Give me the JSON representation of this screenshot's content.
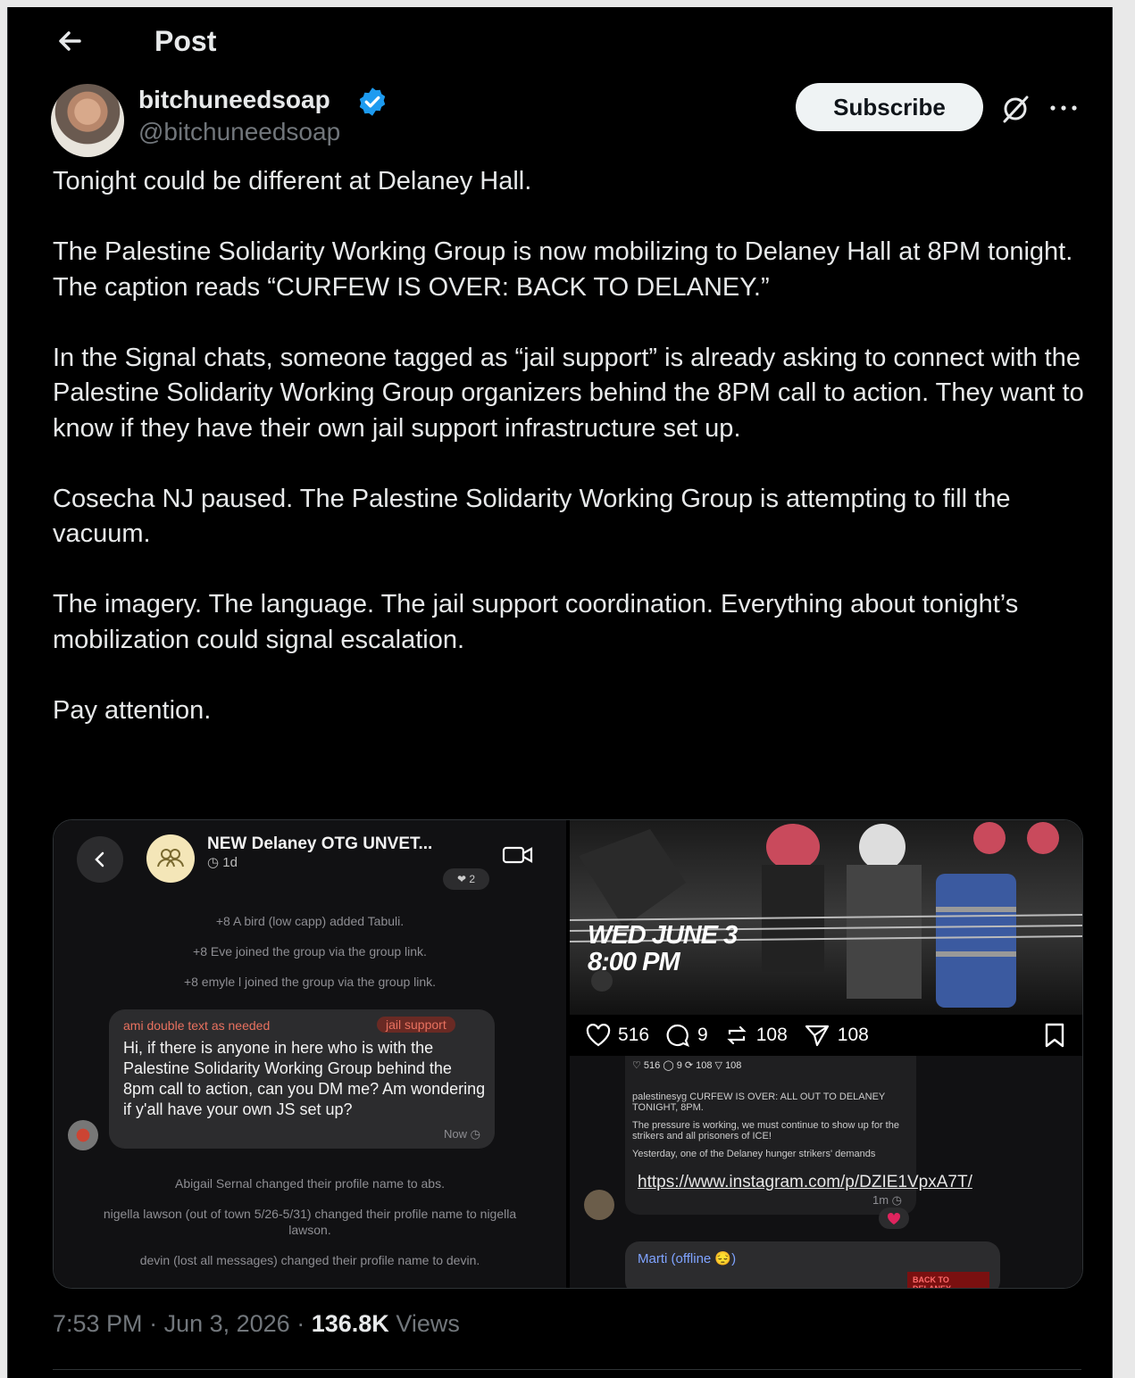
{
  "header": {
    "title": "Post"
  },
  "author": {
    "display_name": "bitchuneedsoap",
    "handle": "@bitchuneedsoap",
    "verified": true
  },
  "actions": {
    "subscribe_label": "Subscribe"
  },
  "tweet": {
    "paragraphs": [
      "Tonight could be different at Delaney Hall.",
      "The Palestine Solidarity Working Group is now mobilizing to Delaney Hall at 8PM tonight. The caption reads “CURFEW IS OVER: BACK TO DELANEY.”",
      "In the Signal chats, someone tagged as “jail support” is already asking to connect with the Palestine Solidarity Working Group organizers behind the 8PM call to action. They want to know if they have their own jail support infrastructure set up.",
      "Cosecha NJ paused. The Palestine Solidarity Working Group is attempting to fill the vacuum.",
      "The imagery. The language. The jail support coordination. Everything about tonight’s mobilization could signal escalation.",
      "Pay attention."
    ]
  },
  "media_left": {
    "group_title": "NEW Delaney OTG UNVET...",
    "group_sub": "◷ 1d",
    "reaction": "❤ 2",
    "system_lines": [
      "+8 A bird (low capp) added Tabuli.",
      "+8 Eve joined the group via the group link.",
      "+8 emyle l joined the group via the group link."
    ],
    "bubble": {
      "sender": "ami double text as needed",
      "tag": "jail support",
      "text": "Hi, if there is anyone in here who is with the Palestine Solidarity Working Group behind the 8pm call to action, can you DM me? Am wondering if y'all have your own JS set up?",
      "time": "Now ◷"
    },
    "system_lines_after": [
      "Abigail Sernal changed their profile name to abs.",
      "nigella lawson (out of town 5/26-5/31) changed their profile name to nigella lawson.",
      "devin (lost all messages) changed their profile name to devin."
    ]
  },
  "media_right": {
    "poster_date": "WED JUNE 3",
    "poster_time": "8:00 PM",
    "stats": {
      "likes": "516",
      "comments": "9",
      "reposts": "108",
      "shares": "108"
    },
    "insta_mini_stats": "♡ 516  ◯ 9  ⟳ 108  ▽ 108",
    "caption": "palestinesyg CURFEW IS OVER: ALL OUT TO DELANEY TONIGHT, 8PM.",
    "caption_2": "The pressure is working, we must continue to show up for the strikers and all prisoners of ICE!",
    "caption_3": "Yesterday, one of the Delaney hunger strikers' demands",
    "link": "https://www.instagram.com/p/DZIE1VpxA7T/",
    "link_time": "1m ◷",
    "marti_name": "Marti (offline 😔)",
    "marti_preview": "BACK TO DELANEY"
  },
  "meta": {
    "time": "7:53 PM",
    "date": "Jun 3, 2026",
    "views_count": "136.8K",
    "views_label": "Views"
  },
  "colors": {
    "background": "#000000",
    "text": "#e7e9ea",
    "secondary": "#71767b",
    "verified": "#1d9bf0"
  }
}
